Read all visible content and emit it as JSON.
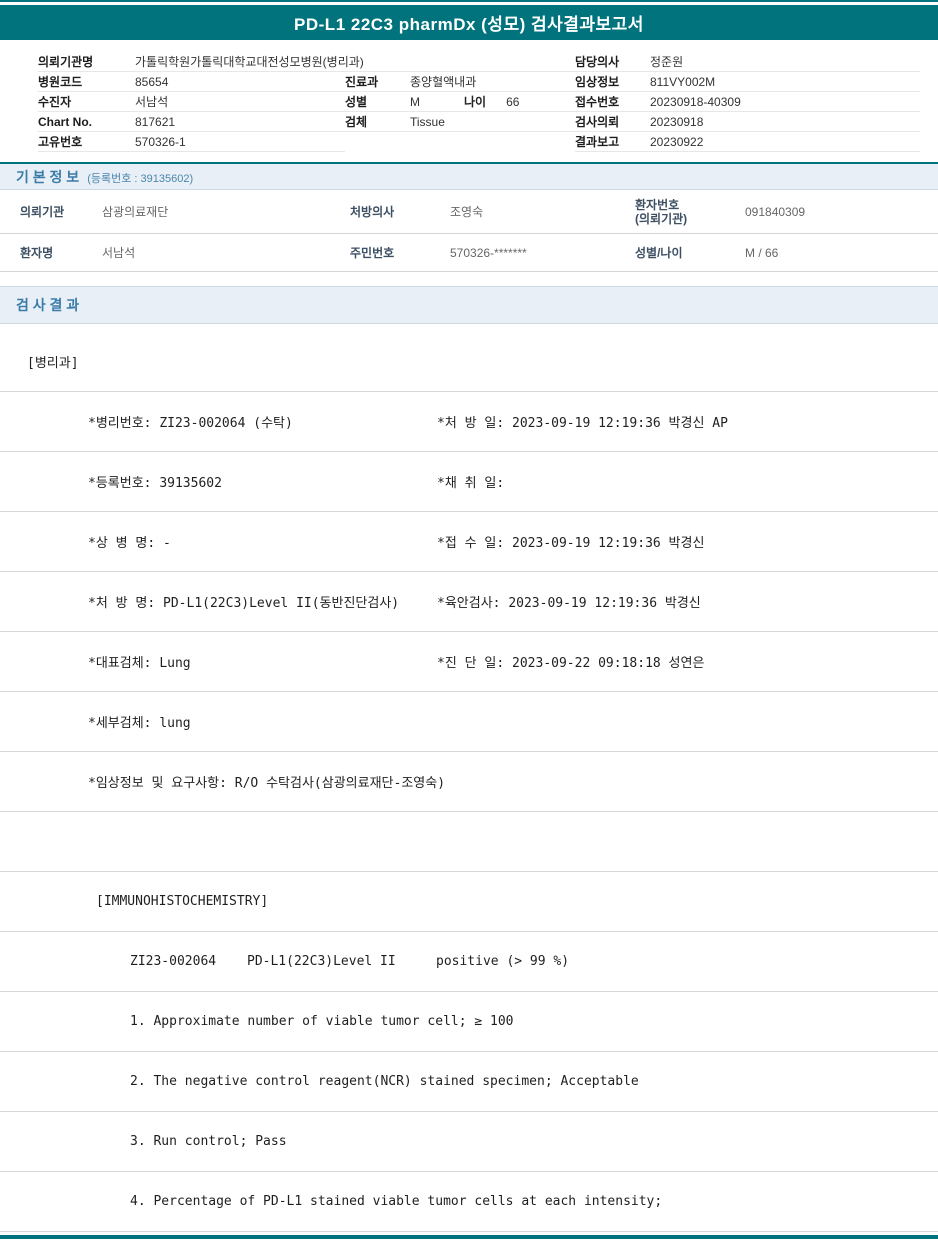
{
  "banner": {
    "title": "PD-L1 22C3 pharmDx (성모) 검사결과보고서"
  },
  "patient_header": {
    "rows": [
      {
        "l_label": "의뢰기관명",
        "l_value": "가톨릭학원가톨릭대학교대전성모병원(병리과)",
        "r_label": "담당의사",
        "r_value": "정준원"
      },
      {
        "l_label": "병원코드",
        "l_value": "85654",
        "m_label": "진료과",
        "m_value": "종양혈액내과",
        "r_label": "임상정보",
        "r_value": "811VY002M"
      },
      {
        "l_label": "수진자",
        "l_value": "서남석",
        "m_label": "성별",
        "m_value": "M",
        "m_label2": "나이",
        "m_value2": "66",
        "r_label": "접수번호",
        "r_value": "20230918-40309"
      },
      {
        "l_label": "Chart No.",
        "l_value": "817621",
        "m_label": "검체",
        "m_value": "Tissue",
        "r_label": "검사의뢰",
        "r_value": "20230918"
      },
      {
        "l_label": "고유번호",
        "l_value": "570326-1",
        "r_label": "결과보고",
        "r_value": "20230922"
      }
    ]
  },
  "basic_info": {
    "title": "기 본 정 보",
    "subtitle": "(등록번호 : 39135602)",
    "rows": [
      {
        "c1": "의뢰기관",
        "v1": "삼광의료재단",
        "c2": "처방의사",
        "v2": "조영숙",
        "c3": "환자번호",
        "c3_sub": "(의뢰기관)",
        "v3": "091840309"
      },
      {
        "c1": "환자명",
        "v1": "서남석",
        "c2": "주민번호",
        "v2": "570326-*******",
        "c3": "성별/나이",
        "c3_sub": "",
        "v3": "M / 66"
      }
    ]
  },
  "results": {
    "title": "검 사 결 과",
    "department": "[병리과]",
    "detail_rows": [
      {
        "left": "*병리번호: ZI23-002064 (수탁)",
        "right": "*처 방 일: 2023-09-19 12:19:36  박경신 AP"
      },
      {
        "left": "*등록번호: 39135602",
        "right": "*채 취 일:"
      },
      {
        "left": "*상 병 명: -",
        "right": "*접 수 일: 2023-09-19 12:19:36  박경신"
      },
      {
        "left": "*처 방 명: PD-L1(22C3)Level II(동반진단검사)",
        "right": "*육안검사: 2023-09-19 12:19:36  박경신"
      },
      {
        "left": "*대표검체: Lung",
        "right": "*진 단 일: 2023-09-22 09:18:18  성연은"
      },
      {
        "left": "*세부검체: lung",
        "right": ""
      },
      {
        "left": "*임상정보 및 요구사항: R/O 수탁검사(삼광의료재단-조영숙)",
        "right": ""
      }
    ],
    "ihc": {
      "section_label": "[IMMUNOHISTOCHEMISTRY]",
      "specimen_no": "ZI23-002064",
      "test_name": "PD-L1(22C3)Level II",
      "result": "positive (> 99 %)",
      "findings": [
        "1. Approximate number of viable tumor cell; ≥ 100",
        "2. The negative control reagent(NCR) stained specimen; Acceptable",
        "3. Run control; Pass",
        "4. Percentage of PD-L1 stained viable tumor cells at each intensity;"
      ]
    }
  },
  "colors": {
    "accent_teal": "#00737c",
    "section_bg": "#e9eff6",
    "section_text": "#3a7ca8"
  }
}
